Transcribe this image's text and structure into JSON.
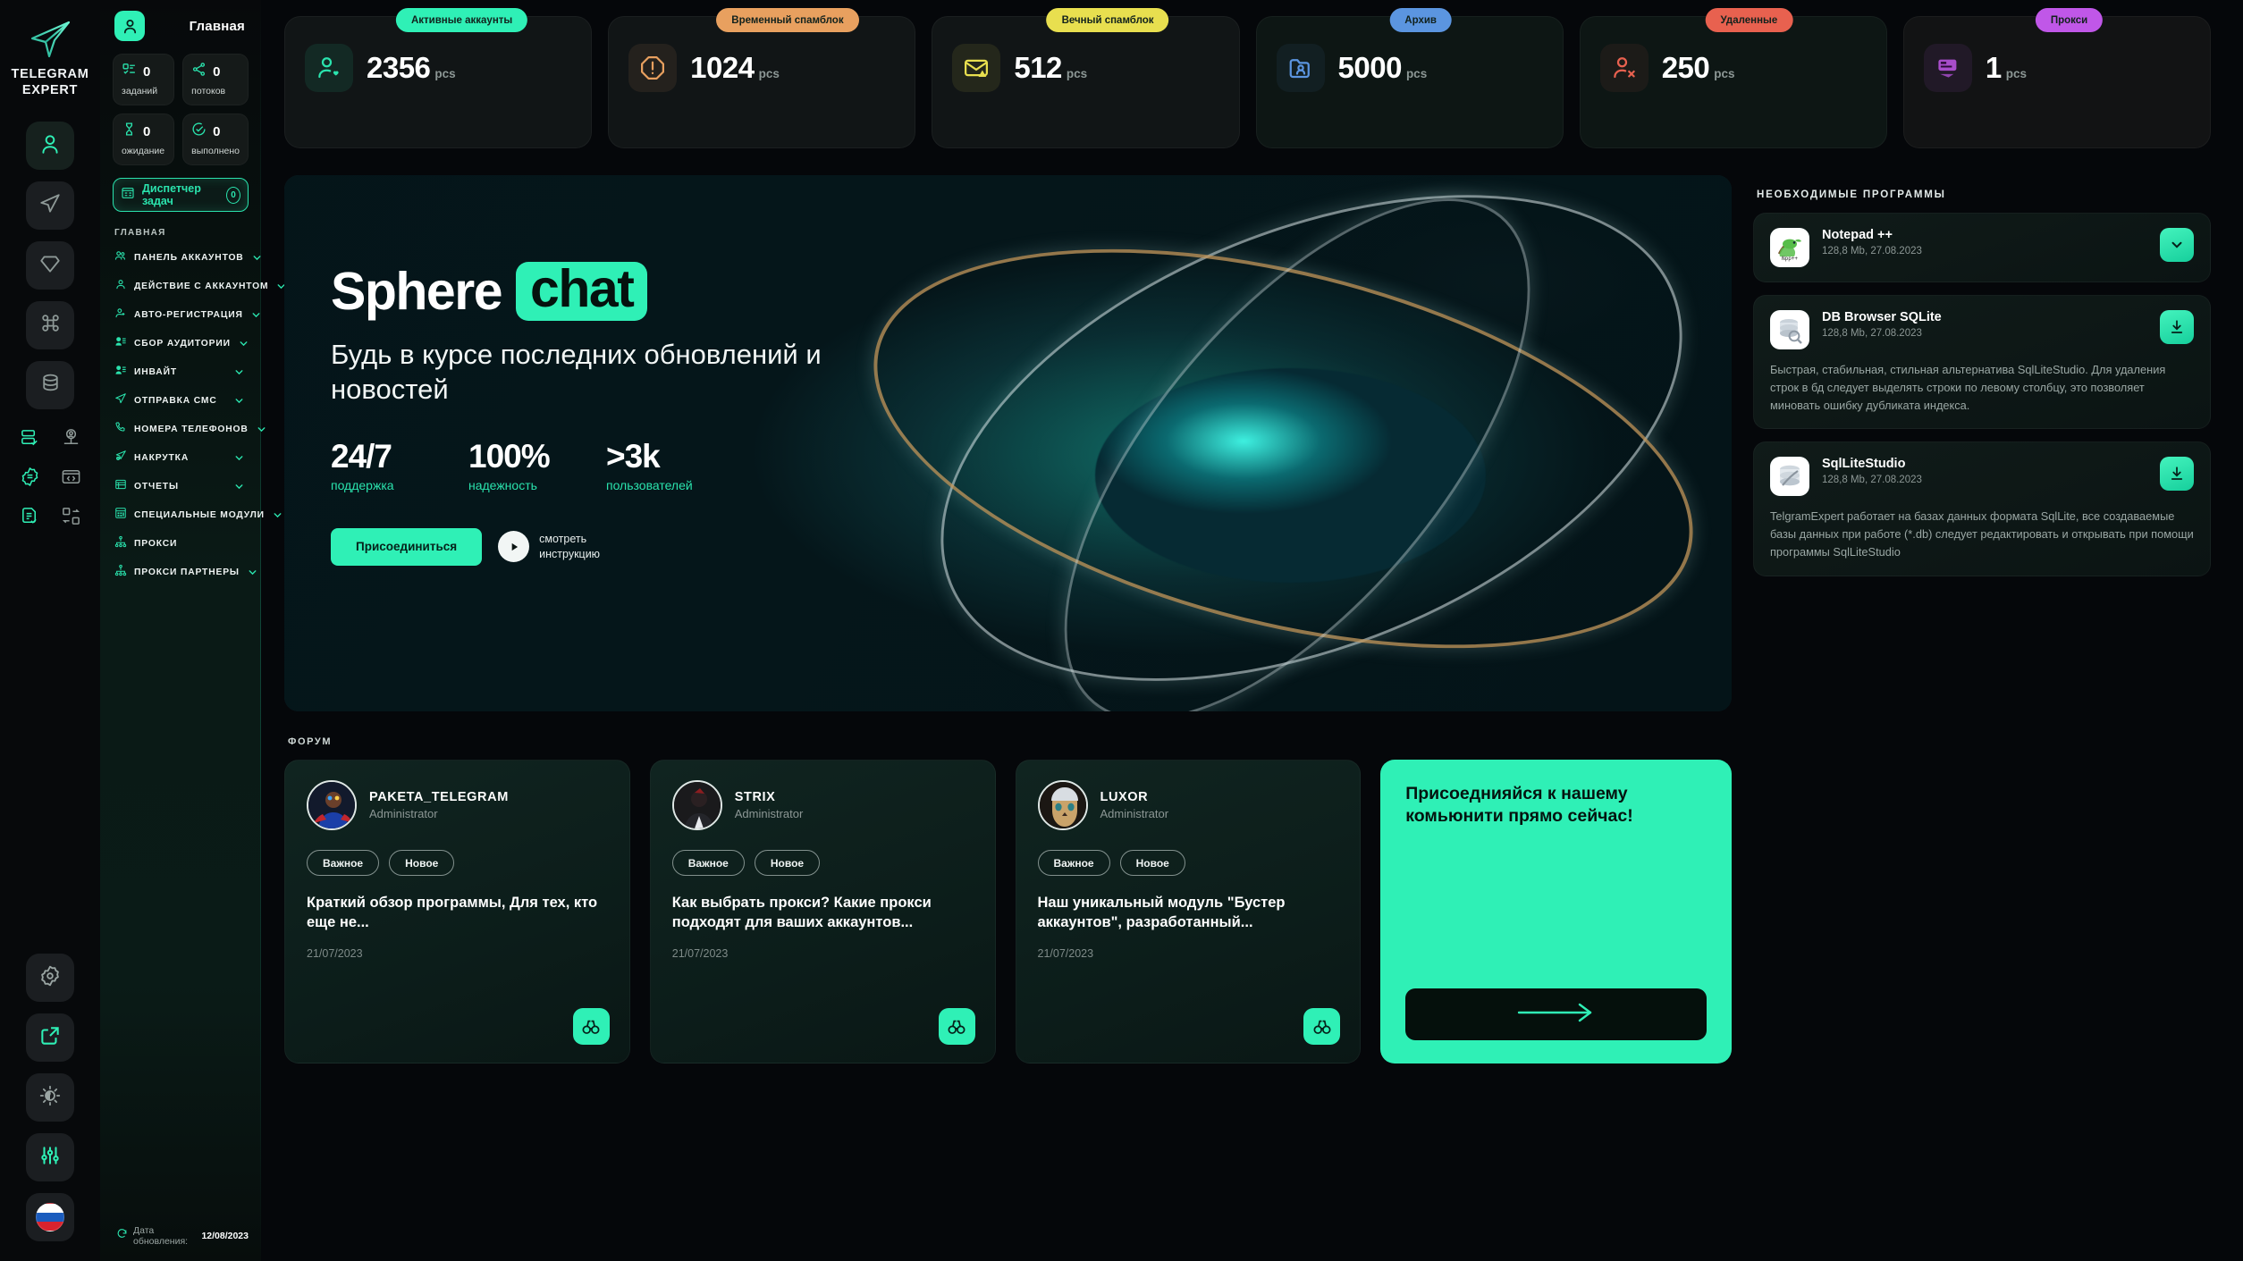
{
  "brand": {
    "logo_icon": "telegram-paper-plane-icon",
    "name_line1": "TELEGRAM",
    "name_line2": "EXPERT"
  },
  "rail": {
    "icons": [
      {
        "name": "account-icon",
        "glyph": "person",
        "active": true
      },
      {
        "name": "send-icon",
        "glyph": "plane",
        "active": false
      },
      {
        "name": "diamond-icon",
        "glyph": "diamond",
        "active": false
      },
      {
        "name": "command-icon",
        "glyph": "command",
        "active": false
      },
      {
        "name": "database-icon",
        "glyph": "database",
        "active": false
      }
    ],
    "mini_icons": [
      {
        "name": "server-check-icon"
      },
      {
        "name": "user-network-icon"
      },
      {
        "name": "gear-badge-icon"
      },
      {
        "name": "code-window-icon"
      },
      {
        "name": "document-check-icon"
      },
      {
        "name": "swap-blocks-icon"
      }
    ],
    "bottom_icons": [
      {
        "name": "settings-gear-icon"
      },
      {
        "name": "external-link-icon"
      },
      {
        "name": "theme-brightness-icon"
      },
      {
        "name": "equalizer-sliders-icon"
      },
      {
        "name": "language-flag-ru-icon"
      }
    ]
  },
  "nav": {
    "title": "Главная",
    "avatar_icon": "user-avatar-icon",
    "stats": [
      {
        "icon": "tasks-list-icon",
        "value": "0",
        "label": "заданий"
      },
      {
        "icon": "threads-share-icon",
        "value": "0",
        "label": "потоков"
      },
      {
        "icon": "hourglass-icon",
        "value": "0",
        "label": "ожидание"
      },
      {
        "icon": "check-circle-icon",
        "value": "0",
        "label": "выполнено"
      }
    ],
    "task_manager": {
      "icon": "task-manager-icon",
      "label": "Диспетчер задач",
      "badge": "0"
    },
    "section_label": "ГЛАВНАЯ",
    "items": [
      {
        "icon": "accounts-panel-icon",
        "label": "ПАНЕЛЬ АККАУНТОВ",
        "chevron": true
      },
      {
        "icon": "account-action-icon",
        "label": "ДЕЙСТВИЕ С АККАУНТОМ",
        "chevron": true
      },
      {
        "icon": "auto-register-icon",
        "label": "АВТО-РЕГИСТРАЦИЯ",
        "chevron": true
      },
      {
        "icon": "audience-collect-icon",
        "label": "СБОР АУДИТОРИИ",
        "chevron": true
      },
      {
        "icon": "invite-icon",
        "label": "ИНВАЙТ",
        "chevron": true
      },
      {
        "icon": "send-sms-icon",
        "label": "ОТПРАВКА СМС",
        "chevron": true
      },
      {
        "icon": "phone-numbers-icon",
        "label": "НОМЕРА ТЕЛЕФОНОВ",
        "chevron": true
      },
      {
        "icon": "boost-icon",
        "label": "НАКРУТКА",
        "chevron": true
      },
      {
        "icon": "reports-icon",
        "label": "ОТЧЕТЫ",
        "chevron": true
      },
      {
        "icon": "special-modules-icon",
        "label": "СПЕЦИАЛЬНЫЕ МОДУЛИ",
        "chevron": true
      },
      {
        "icon": "proxy-icon",
        "label": "ПРОКСИ",
        "chevron": false
      },
      {
        "icon": "proxy-partners-icon",
        "label": "ПРОКСИ ПАРТНЕРЫ",
        "chevron": true
      }
    ],
    "footer": {
      "icon": "refresh-icon",
      "label": "Дата обновления:",
      "date": "12/08/2023"
    }
  },
  "topstats": [
    {
      "chip": "Активные аккаунты",
      "chip_color": "#2ff0b6",
      "icon": "user-heart-icon",
      "icon_color": "#2ae3ad",
      "value": "2356",
      "unit": "pcs"
    },
    {
      "chip": "Временный спамблок",
      "chip_color": "#e8a05f",
      "icon": "warning-octagon-icon",
      "icon_color": "#e8a05f",
      "value": "1024",
      "unit": "pcs"
    },
    {
      "chip": "Вечный спамблок",
      "chip_color": "#e8df4f",
      "icon": "mail-blocked-icon",
      "icon_color": "#e8df4f",
      "value": "512",
      "unit": "pcs"
    },
    {
      "chip": "Архив",
      "chip_color": "#5b95e0",
      "icon": "folder-user-icon",
      "icon_color": "#5b95e0",
      "value": "5000",
      "unit": "pcs"
    },
    {
      "chip": "Удаленные",
      "chip_color": "#e8614f",
      "icon": "user-remove-icon",
      "icon_color": "#e8614f",
      "value": "250",
      "unit": "pcs"
    },
    {
      "chip": "Прокси",
      "chip_color": "#c057e8",
      "icon": "proxy-card-icon",
      "icon_color": "#c057e8",
      "value": "1",
      "unit": "pcs"
    }
  ],
  "hero": {
    "brand_word1": "Sphere",
    "brand_word2": "chat",
    "subtitle": "Будь в курсе последних обновлений и новостей",
    "kpis": [
      {
        "value": "24/7",
        "label": "поддержка"
      },
      {
        "value": "100%",
        "label": "надежность"
      },
      {
        "value": ">3k",
        "label": "пользователей"
      }
    ],
    "join_label": "Присоединиться",
    "play_icon": "play-icon",
    "play_label_line1": "смотреть",
    "play_label_line2": "инструкцию"
  },
  "forum": {
    "label": "ФОРУМ",
    "cards": [
      {
        "avatar_icon": "avatar-paketa-icon",
        "name": "PAKETA_TELEGRAM",
        "role": "Administrator",
        "tags": [
          "Важное",
          "Новое"
        ],
        "title": "Краткий обзор программы, Для тех, кто еще не...",
        "date": "21/07/2023",
        "action_icon": "binoculars-icon"
      },
      {
        "avatar_icon": "avatar-strix-icon",
        "name": "STRIX",
        "role": "Administrator",
        "tags": [
          "Важное",
          "Новое"
        ],
        "title": "Как выбрать прокси? Какие прокси подходят для ваших аккаунтов...",
        "date": "21/07/2023",
        "action_icon": "binoculars-icon"
      },
      {
        "avatar_icon": "avatar-luxor-icon",
        "name": "LUXOR",
        "role": "Administrator",
        "tags": [
          "Важное",
          "Новое"
        ],
        "title": "Наш уникальный модуль \"Бустер аккаунтов\", разработанный...",
        "date": "21/07/2023",
        "action_icon": "binoculars-icon"
      }
    ],
    "promo": {
      "text": "Присоеднияйся к нашему комьюнити  прямо сейчас!",
      "arrow_icon": "arrow-right-icon"
    }
  },
  "programs": {
    "label": "НЕОБХОДИМЫЕ ПРОГРАММЫ",
    "items": [
      {
        "icon": "notepadpp-icon",
        "name": "Notepad ++",
        "meta": "128,8 Mb, 27.08.2023",
        "action_icon": "chevron-down-icon",
        "description": ""
      },
      {
        "icon": "dbbrowser-sqlite-icon",
        "name": "DB Browser SQLite",
        "meta": "128,8 Mb, 27.08.2023",
        "action_icon": "download-icon",
        "description": "Быстрая, стабильная, стильная альтернатива SqlLiteStudio. Для удаления строк в бд следует выделять строки по левому столбцу, это позволяет миновать ошибку дубликата индекса."
      },
      {
        "icon": "sqlitestudio-icon",
        "name": "SqlLiteStudio",
        "meta": "128,8 Mb, 27.08.2023",
        "action_icon": "download-icon",
        "description": "TelgramExpert работает на базах данных формата SqlLite, все создаваемые базы данных при работе (*.db) следует редактировать и открывать при помощи программы SqlLiteStudio"
      }
    ]
  },
  "colors": {
    "accent": "#2ff0b6",
    "accent_dim": "#2ae3ad",
    "bg": "#05070a",
    "panel": "#111516"
  }
}
